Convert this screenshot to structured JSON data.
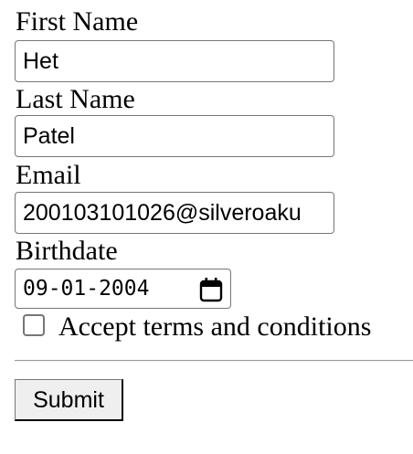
{
  "form": {
    "first_name": {
      "label": "First Name",
      "value": "Het"
    },
    "last_name": {
      "label": "Last Name",
      "value": "Patel"
    },
    "email": {
      "label": "Email",
      "value": "200103101026@silveroaku"
    },
    "birthdate": {
      "label": "Birthdate",
      "value": "09-01-2004",
      "icon": "calendar-icon"
    },
    "terms": {
      "label": "Accept terms and conditions",
      "checked": false
    },
    "submit_label": "Submit"
  },
  "colors": {
    "input_border": "#767676",
    "button_background": "#efefef",
    "text": "#000000"
  }
}
